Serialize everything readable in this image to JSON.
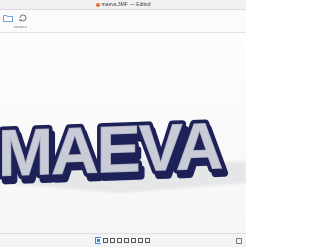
{
  "window": {
    "title": "maeva.3MF",
    "title_suffix": "— Edited"
  },
  "toolbar": {
    "tools": [
      {
        "name": "folder-icon",
        "label": ""
      },
      {
        "name": "rotate-icon",
        "label": "MODELS"
      }
    ]
  },
  "model": {
    "text": "MAEVA",
    "fill_color": "#c9ccd6",
    "outline_color": "#1d2157",
    "shadow_color": "#9a9ca3"
  },
  "statusbar": {
    "buttons": [
      "select-icon",
      "move-icon",
      "rotate-icon",
      "scale-icon",
      "zoom-icon",
      "camera-icon",
      "settings-icon",
      "info-icon"
    ]
  },
  "colors": {
    "accent": "#2e8be0",
    "title_icon": "#e8783a"
  }
}
